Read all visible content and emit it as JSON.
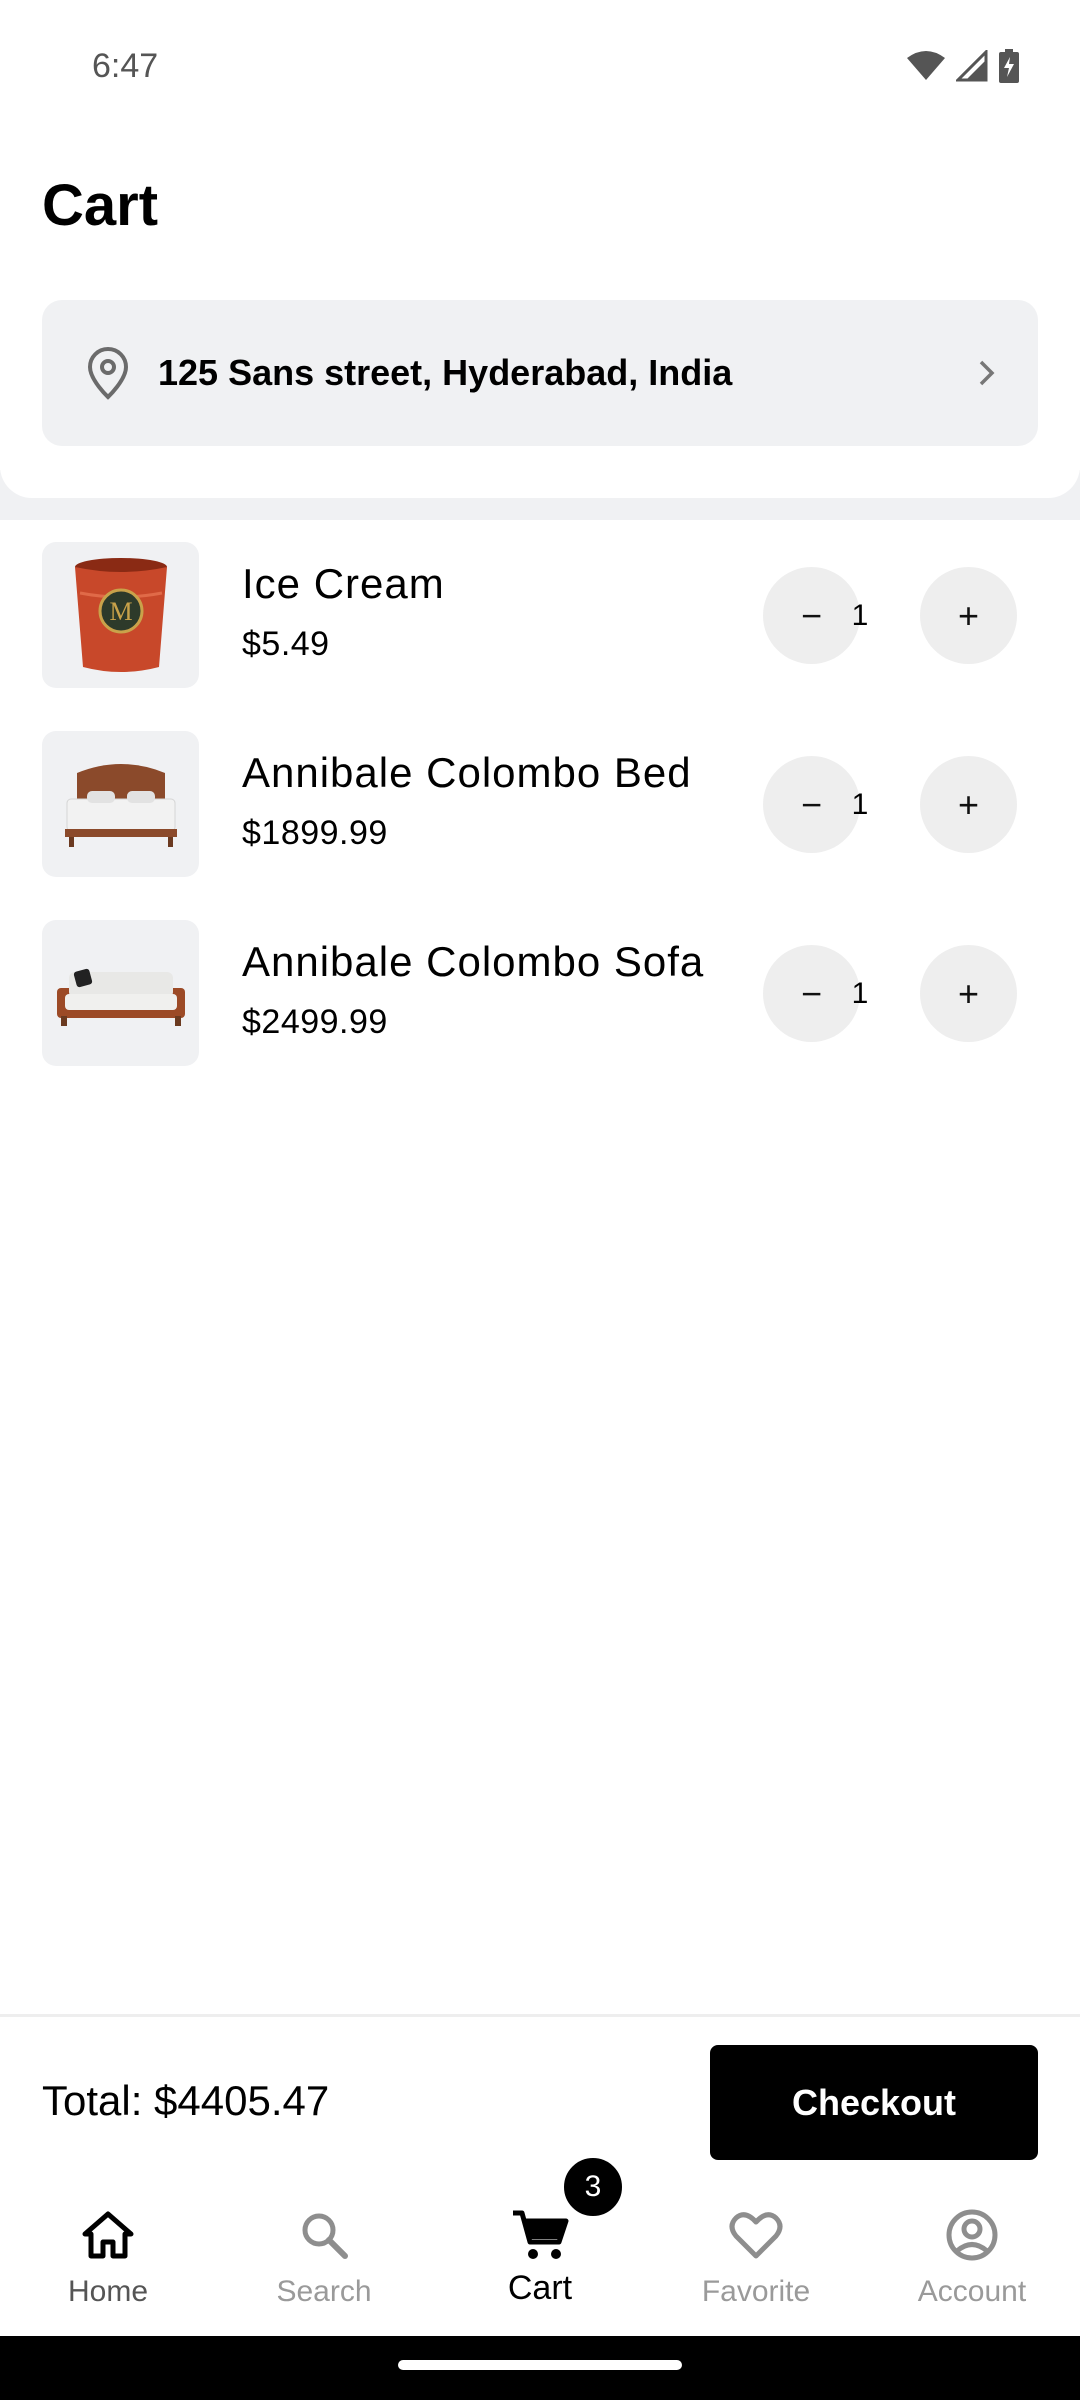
{
  "status_bar": {
    "time": "6:47"
  },
  "header": {
    "title": "Cart",
    "address": "125 Sans street, Hyderabad, India"
  },
  "cart": {
    "items": [
      {
        "name": "Ice Cream",
        "price": "$5.49",
        "quantity": "1",
        "image_icon": "ice-cream-tub-icon"
      },
      {
        "name": "Annibale Colombo Bed",
        "price": "$1899.99",
        "quantity": "1",
        "image_icon": "bed-icon"
      },
      {
        "name": "Annibale Colombo Sofa",
        "price": "$2499.99",
        "quantity": "1",
        "image_icon": "sofa-icon"
      }
    ],
    "minus_symbol": "−",
    "plus_symbol": "+"
  },
  "checkout": {
    "total": "Total: $4405.47",
    "button_label": "Checkout"
  },
  "bottom_nav": {
    "items": [
      {
        "label": "Home",
        "icon": "home-icon"
      },
      {
        "label": "Search",
        "icon": "search-icon"
      },
      {
        "label": "Cart",
        "icon": "cart-icon",
        "badge": "3",
        "active": true
      },
      {
        "label": "Favorite",
        "icon": "heart-icon"
      },
      {
        "label": "Account",
        "icon": "account-icon"
      }
    ]
  },
  "colors": {
    "card_bg": "#f0f1f3",
    "qty_button_bg": "#eeeeee",
    "primary": "#000000",
    "inactive_nav": "#9a9a9a"
  }
}
